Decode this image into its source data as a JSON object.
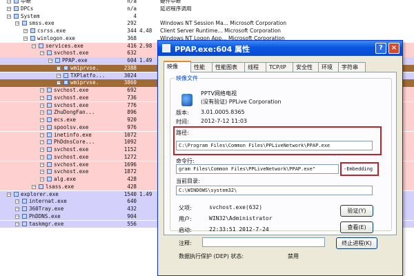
{
  "process_list": [
    {
      "name": "中断",
      "pid": "n/a",
      "cpu": "",
      "desc": "硬件中断",
      "indent": 1,
      "color": "white"
    },
    {
      "name": "DPCs",
      "pid": "n/a",
      "cpu": "",
      "desc": "延迟程序调用",
      "indent": 1,
      "color": "white"
    },
    {
      "name": "System",
      "pid": "4",
      "cpu": "",
      "desc": "",
      "indent": 1,
      "color": "white"
    },
    {
      "name": "smss.exe",
      "pid": "292",
      "cpu": "",
      "desc": "Windows NT Session Ma... Microsoft Corporation",
      "indent": 2,
      "color": "white"
    },
    {
      "name": "csrss.exe",
      "pid": "344",
      "cpu": "4.48",
      "desc": "Client Server Runtime... Microsoft Corporation",
      "indent": 3,
      "color": "white"
    },
    {
      "name": "winlogon.exe",
      "pid": "368",
      "cpu": "",
      "desc": "Windows NT Logon App... Microsoft Corporation",
      "indent": 3,
      "color": "white"
    },
    {
      "name": "services.exe",
      "pid": "416",
      "cpu": "2.98",
      "desc": "",
      "indent": 4,
      "color": "pink"
    },
    {
      "name": "svchost.exe",
      "pid": "632",
      "cpu": "",
      "desc": "",
      "indent": 5,
      "color": "pink"
    },
    {
      "name": "PPAP.exe",
      "pid": "604",
      "cpu": "1.49",
      "desc": "",
      "indent": 6,
      "color": "lav"
    },
    {
      "name": "wmiprvse.",
      "pid": "2388",
      "cpu": "",
      "desc": "",
      "indent": 7,
      "color": "sel"
    },
    {
      "name": "TXPlatfo...",
      "pid": "3024",
      "cpu": "",
      "desc": "",
      "indent": 7,
      "color": "lav"
    },
    {
      "name": "wmiprvse.",
      "pid": "3860",
      "cpu": "",
      "desc": "",
      "indent": 7,
      "color": "sel"
    },
    {
      "name": "svchost.exe",
      "pid": "692",
      "cpu": "",
      "desc": "",
      "indent": 5,
      "color": "pink"
    },
    {
      "name": "svchost.exe",
      "pid": "736",
      "cpu": "",
      "desc": "",
      "indent": 5,
      "color": "pink"
    },
    {
      "name": "svchost.exe",
      "pid": "776",
      "cpu": "",
      "desc": "",
      "indent": 5,
      "color": "pink"
    },
    {
      "name": "ZhuDongFan...",
      "pid": "896",
      "cpu": "",
      "desc": "",
      "indent": 5,
      "color": "pink"
    },
    {
      "name": "ecs.exe",
      "pid": "920",
      "cpu": "",
      "desc": "",
      "indent": 5,
      "color": "pink"
    },
    {
      "name": "spoolsv.exe",
      "pid": "976",
      "cpu": "",
      "desc": "",
      "indent": 5,
      "color": "pink"
    },
    {
      "name": "inetinfo.exe",
      "pid": "1072",
      "cpu": "",
      "desc": "",
      "indent": 5,
      "color": "pink"
    },
    {
      "name": "PhDdnsCore...",
      "pid": "1092",
      "cpu": "",
      "desc": "",
      "indent": 5,
      "color": "pink"
    },
    {
      "name": "svchost.exe",
      "pid": "1152",
      "cpu": "",
      "desc": "",
      "indent": 5,
      "color": "pink"
    },
    {
      "name": "svchost.exe",
      "pid": "1272",
      "cpu": "",
      "desc": "",
      "indent": 5,
      "color": "pink"
    },
    {
      "name": "svchost.exe",
      "pid": "1696",
      "cpu": "",
      "desc": "",
      "indent": 5,
      "color": "pink"
    },
    {
      "name": "svchost.exe",
      "pid": "1872",
      "cpu": "",
      "desc": "",
      "indent": 5,
      "color": "pink"
    },
    {
      "name": "alg.exe",
      "pid": "428",
      "cpu": "",
      "desc": "",
      "indent": 5,
      "color": "pink"
    },
    {
      "name": "lsass.exe",
      "pid": "428",
      "cpu": "",
      "desc": "",
      "indent": 4,
      "color": "pink"
    },
    {
      "name": "explorer.exe",
      "pid": "1540",
      "cpu": "1.49",
      "desc": "",
      "indent": 1,
      "color": "lav"
    },
    {
      "name": "internat.exe",
      "pid": "640",
      "cpu": "",
      "desc": "",
      "indent": 2,
      "color": "lav"
    },
    {
      "name": "360Tray.exe",
      "pid": "432",
      "cpu": "",
      "desc": "",
      "indent": 2,
      "color": "lav"
    },
    {
      "name": "PhDDNS.exe",
      "pid": "904",
      "cpu": "",
      "desc": "",
      "indent": 2,
      "color": "lav"
    },
    {
      "name": "taskmgr.exe",
      "pid": "556",
      "cpu": "",
      "desc": "",
      "indent": 2,
      "color": "lav"
    }
  ],
  "dialog": {
    "title": "PPAP.exe:604 属性",
    "help_label": "?",
    "close_label": "×",
    "tabs": [
      "映像",
      "性能",
      "性能图表",
      "线程",
      "TCP/IP",
      "安全性",
      "环境",
      "字符串"
    ],
    "group_label": "映像文件",
    "app_name": "PPTV网络电视",
    "verified": "(没有验证) PPLive Corporation",
    "version_label": "版本:",
    "version_value": "3.01.0005.8365",
    "time_label": "时间:",
    "time_value": "2012-7-12 11:03",
    "path_label": "路径:",
    "path_value": "C:\\Program Files\\Common Files\\PPLiveNetwork\\PPAP.exe",
    "cmdline_label": "命令行:",
    "cmdline_value": "gram Files\\Common Files\\PPLiveNetwork\\PPAP.exe\"",
    "cmdline_suffix": "-Embedding",
    "curdir_label": "当前目录:",
    "curdir_value": "C:\\WINDOWS\\system32\\",
    "parent_label": "父项:",
    "parent_value": "svchost.exe(632)",
    "user_label": "用户:",
    "user_value": "WIN32\\Administrator",
    "start_label": "启动:",
    "start_value": "22:33:51   2012-7-24",
    "comment_label": "注释:",
    "dep_label": "数据执行保护 (DEP) 状态:",
    "dep_value": "禁用",
    "verify_button": "验证(Y)",
    "explore_button": "查看(E)",
    "kill_button": "终止进程(K)"
  },
  "colors": {
    "pink": "#ffd0d0",
    "lavender": "#d4d0fc",
    "selected": "#a06a34",
    "title_bar": "#0a55e0",
    "highlight_box": "#c0202a"
  }
}
